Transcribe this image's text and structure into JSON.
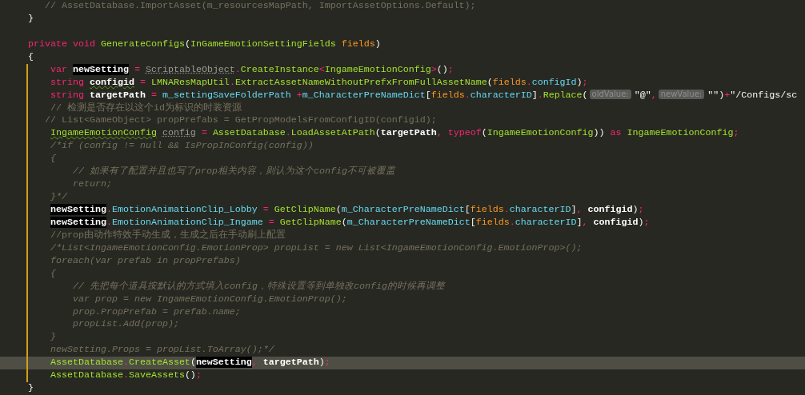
{
  "lines": [
    {
      "tokens": [
        {
          "text": "   // AssetDatabase.ImportAsset(m_resourcesMapPath, ImportAssetOptions.Default);",
          "kind": "comment"
        }
      ]
    },
    {
      "tokens": [
        {
          "text": "}",
          "kind": "plain"
        }
      ]
    },
    {
      "gap_above": true,
      "tokens": [
        {
          "text": "private void ",
          "kind": "keyword"
        },
        {
          "text": "GenerateConfigs",
          "kind": "type"
        },
        {
          "text": "(",
          "kind": "plain"
        },
        {
          "text": "InGameEmotionSettingFields",
          "kind": "type"
        },
        {
          "text": " fields",
          "kind": "param"
        },
        {
          "text": ")",
          "kind": "plain"
        }
      ]
    },
    {
      "tokens": [
        {
          "text": "{",
          "kind": "plain"
        }
      ]
    },
    {
      "changed": true,
      "tokens": [
        {
          "text": "    var ",
          "kind": "keyword"
        },
        {
          "text": "newSetting",
          "kind": "usage"
        },
        {
          "text": " = ",
          "kind": "keyword"
        },
        {
          "text": "ScriptableObject",
          "kind": "dim"
        },
        {
          "text": ".",
          "kind": "keyword"
        },
        {
          "text": "CreateInstance",
          "kind": "type"
        },
        {
          "text": "<",
          "kind": "keyword"
        },
        {
          "text": "IngameEmotionConfig",
          "kind": "type"
        },
        {
          "text": ">",
          "kind": "keyword"
        },
        {
          "text": "()",
          "kind": "plain"
        },
        {
          "text": ";",
          "kind": "keyword"
        }
      ]
    },
    {
      "changed": true,
      "tokens": [
        {
          "text": "    string ",
          "kind": "keyword"
        },
        {
          "text": "configid",
          "kind": "local",
          "squiggle": true
        },
        {
          "text": " = ",
          "kind": "keyword"
        },
        {
          "text": "LMNAResMapUtil",
          "kind": "type"
        },
        {
          "text": ".",
          "kind": "keyword"
        },
        {
          "text": "ExtractAssetNameWithoutPrefxFromFullAssetName",
          "kind": "type"
        },
        {
          "text": "(",
          "kind": "plain"
        },
        {
          "text": "fields",
          "kind": "param"
        },
        {
          "text": ".",
          "kind": "keyword"
        },
        {
          "text": "configId",
          "kind": "field"
        },
        {
          "text": ")",
          "kind": "plain"
        },
        {
          "text": ";",
          "kind": "keyword"
        }
      ]
    },
    {
      "changed": true,
      "tokens": [
        {
          "text": "    string ",
          "kind": "keyword"
        },
        {
          "text": "targetPath",
          "kind": "local"
        },
        {
          "text": " = ",
          "kind": "keyword"
        },
        {
          "text": "m_settingSaveFolderPath",
          "kind": "field"
        },
        {
          "text": " +",
          "kind": "keyword"
        },
        {
          "text": "m_CharacterPreNameDict",
          "kind": "field"
        },
        {
          "text": "[",
          "kind": "plain"
        },
        {
          "text": "fields",
          "kind": "param"
        },
        {
          "text": ".",
          "kind": "keyword"
        },
        {
          "text": "characterID",
          "kind": "field"
        },
        {
          "text": "]",
          "kind": "plain"
        },
        {
          "text": ".",
          "kind": "keyword"
        },
        {
          "text": "Replace",
          "kind": "type"
        },
        {
          "text": "(",
          "kind": "plain"
        },
        {
          "text": "oldValue:",
          "kind": "hint"
        },
        {
          "text": "\"@\"",
          "kind": "plain"
        },
        {
          "text": ",",
          "kind": "keyword"
        },
        {
          "text": "newValue:",
          "kind": "hint"
        },
        {
          "text": "\"\")",
          "kind": "plain"
        },
        {
          "text": "+",
          "kind": "keyword"
        },
        {
          "text": "\"/Configs/sc",
          "kind": "plain"
        }
      ]
    },
    {
      "changed": true,
      "tokens": [
        {
          "text": "    // 检测是否存在以这个id为标识的时装资源",
          "kind": "comment"
        }
      ]
    },
    {
      "changed": true,
      "tokens": [
        {
          "text": "   // List<GameObject> propPrefabs = GetPropModelsFromConfigID(configid);",
          "kind": "comment"
        }
      ]
    },
    {
      "changed": true,
      "tokens": [
        {
          "text": "    IngameEmotionConfig ",
          "kind": "type",
          "squiggle": true
        },
        {
          "text": "config",
          "kind": "dim"
        },
        {
          "text": " = ",
          "kind": "keyword"
        },
        {
          "text": "AssetDatabase",
          "kind": "type"
        },
        {
          "text": ".",
          "kind": "keyword"
        },
        {
          "text": "LoadAssetAtPath",
          "kind": "type"
        },
        {
          "text": "(",
          "kind": "plain"
        },
        {
          "text": "targetPath",
          "kind": "local"
        },
        {
          "text": ", typeof",
          "kind": "keyword"
        },
        {
          "text": "(",
          "kind": "plain"
        },
        {
          "text": "IngameEmotionConfig",
          "kind": "type"
        },
        {
          "text": ")) ",
          "kind": "plain"
        },
        {
          "text": "as ",
          "kind": "keyword"
        },
        {
          "text": "IngameEmotionConfig",
          "kind": "type"
        },
        {
          "text": ";",
          "kind": "keyword"
        }
      ]
    },
    {
      "changed": true,
      "tokens": [
        {
          "text": "    /*if (config != null && IsPropInConfig(config))",
          "kind": "block-comment"
        }
      ]
    },
    {
      "changed": true,
      "tokens": [
        {
          "text": "    {",
          "kind": "block-comment"
        }
      ]
    },
    {
      "changed": true,
      "tokens": [
        {
          "text": "        // 如果有了配置并且也写了prop相关内容，则认为这个config不可被覆盖",
          "kind": "block-comment"
        }
      ]
    },
    {
      "changed": true,
      "tokens": [
        {
          "text": "        return;",
          "kind": "block-comment"
        }
      ]
    },
    {
      "changed": true,
      "tokens": [
        {
          "text": "    }*/",
          "kind": "block-comment"
        }
      ]
    },
    {
      "changed": true,
      "tokens": [
        {
          "text": "    newSetting",
          "kind": "usage"
        },
        {
          "text": ".",
          "kind": "keyword"
        },
        {
          "text": "EmotionAnimationClip_Lobby",
          "kind": "field"
        },
        {
          "text": " = ",
          "kind": "keyword"
        },
        {
          "text": "GetClipName",
          "kind": "type"
        },
        {
          "text": "(",
          "kind": "plain"
        },
        {
          "text": "m_CharacterPreNameDict",
          "kind": "field"
        },
        {
          "text": "[",
          "kind": "plain"
        },
        {
          "text": "fields",
          "kind": "param"
        },
        {
          "text": ".",
          "kind": "keyword"
        },
        {
          "text": "characterID",
          "kind": "field"
        },
        {
          "text": "]",
          "kind": "plain"
        },
        {
          "text": ", ",
          "kind": "keyword"
        },
        {
          "text": "configid",
          "kind": "local"
        },
        {
          "text": ")",
          "kind": "plain"
        },
        {
          "text": ";",
          "kind": "keyword"
        }
      ]
    },
    {
      "changed": true,
      "tokens": [
        {
          "text": "    newSetting",
          "kind": "usage"
        },
        {
          "text": ".",
          "kind": "keyword"
        },
        {
          "text": "EmotionAnimationClip_Ingame",
          "kind": "field"
        },
        {
          "text": " = ",
          "kind": "keyword"
        },
        {
          "text": "GetClipName",
          "kind": "type"
        },
        {
          "text": "(",
          "kind": "plain"
        },
        {
          "text": "m_CharacterPreNameDict",
          "kind": "field"
        },
        {
          "text": "[",
          "kind": "plain"
        },
        {
          "text": "fields",
          "kind": "param"
        },
        {
          "text": ".",
          "kind": "keyword"
        },
        {
          "text": "characterID",
          "kind": "field"
        },
        {
          "text": "]",
          "kind": "plain"
        },
        {
          "text": ", ",
          "kind": "keyword"
        },
        {
          "text": "configid",
          "kind": "local"
        },
        {
          "text": ")",
          "kind": "plain"
        },
        {
          "text": ";",
          "kind": "keyword"
        }
      ]
    },
    {
      "changed": true,
      "tokens": [
        {
          "text": "    //prop由动作特效手动生成，生成之后在手动刷上配置",
          "kind": "comment"
        }
      ]
    },
    {
      "changed": true,
      "tokens": [
        {
          "text": "    /*List<IngameEmotionConfig.EmotionProp> propList = new List<IngameEmotionConfig.EmotionProp>();",
          "kind": "block-comment"
        }
      ]
    },
    {
      "changed": true,
      "tokens": [
        {
          "text": "    foreach(var prefab in propPrefabs)",
          "kind": "block-comment"
        }
      ]
    },
    {
      "changed": true,
      "tokens": [
        {
          "text": "    {",
          "kind": "block-comment"
        }
      ]
    },
    {
      "changed": true,
      "tokens": [
        {
          "text": "        // 先把每个道具按默认的方式填入config，特殊设置等到单独改config的时候再调整",
          "kind": "block-comment"
        }
      ]
    },
    {
      "changed": true,
      "tokens": [
        {
          "text": "        var prop = new IngameEmotionConfig.EmotionProp();",
          "kind": "block-comment"
        }
      ]
    },
    {
      "changed": true,
      "tokens": [
        {
          "text": "        prop.PropPrefab = prefab.name;",
          "kind": "block-comment"
        }
      ]
    },
    {
      "changed": true,
      "tokens": [
        {
          "text": "        propList.Add(prop);",
          "kind": "block-comment"
        }
      ]
    },
    {
      "changed": true,
      "tokens": [
        {
          "text": "    }",
          "kind": "block-comment"
        }
      ]
    },
    {
      "changed": true,
      "tokens": [
        {
          "text": "    newSetting.Props = propList.ToArray();*/",
          "kind": "block-comment"
        }
      ]
    },
    {
      "changed": true,
      "current": true,
      "tokens": [
        {
          "text": "    AssetDatabase",
          "kind": "type"
        },
        {
          "text": ".",
          "kind": "keyword"
        },
        {
          "text": "CreateAsset",
          "kind": "type"
        },
        {
          "text": "(",
          "kind": "plain"
        },
        {
          "text": "newSetting",
          "kind": "usage"
        },
        {
          "text": ", ",
          "kind": "keyword"
        },
        {
          "text": "targetPath",
          "kind": "local"
        },
        {
          "text": ")",
          "kind": "plain"
        },
        {
          "text": ";",
          "kind": "keyword"
        }
      ]
    },
    {
      "changed": true,
      "tokens": [
        {
          "text": "    AssetDatabase",
          "kind": "type"
        },
        {
          "text": ".",
          "kind": "keyword"
        },
        {
          "text": "SaveAssets",
          "kind": "type"
        },
        {
          "text": "()",
          "kind": "plain"
        },
        {
          "text": ";",
          "kind": "keyword"
        }
      ]
    },
    {
      "tokens": [
        {
          "text": "}",
          "kind": "plain"
        }
      ]
    }
  ]
}
